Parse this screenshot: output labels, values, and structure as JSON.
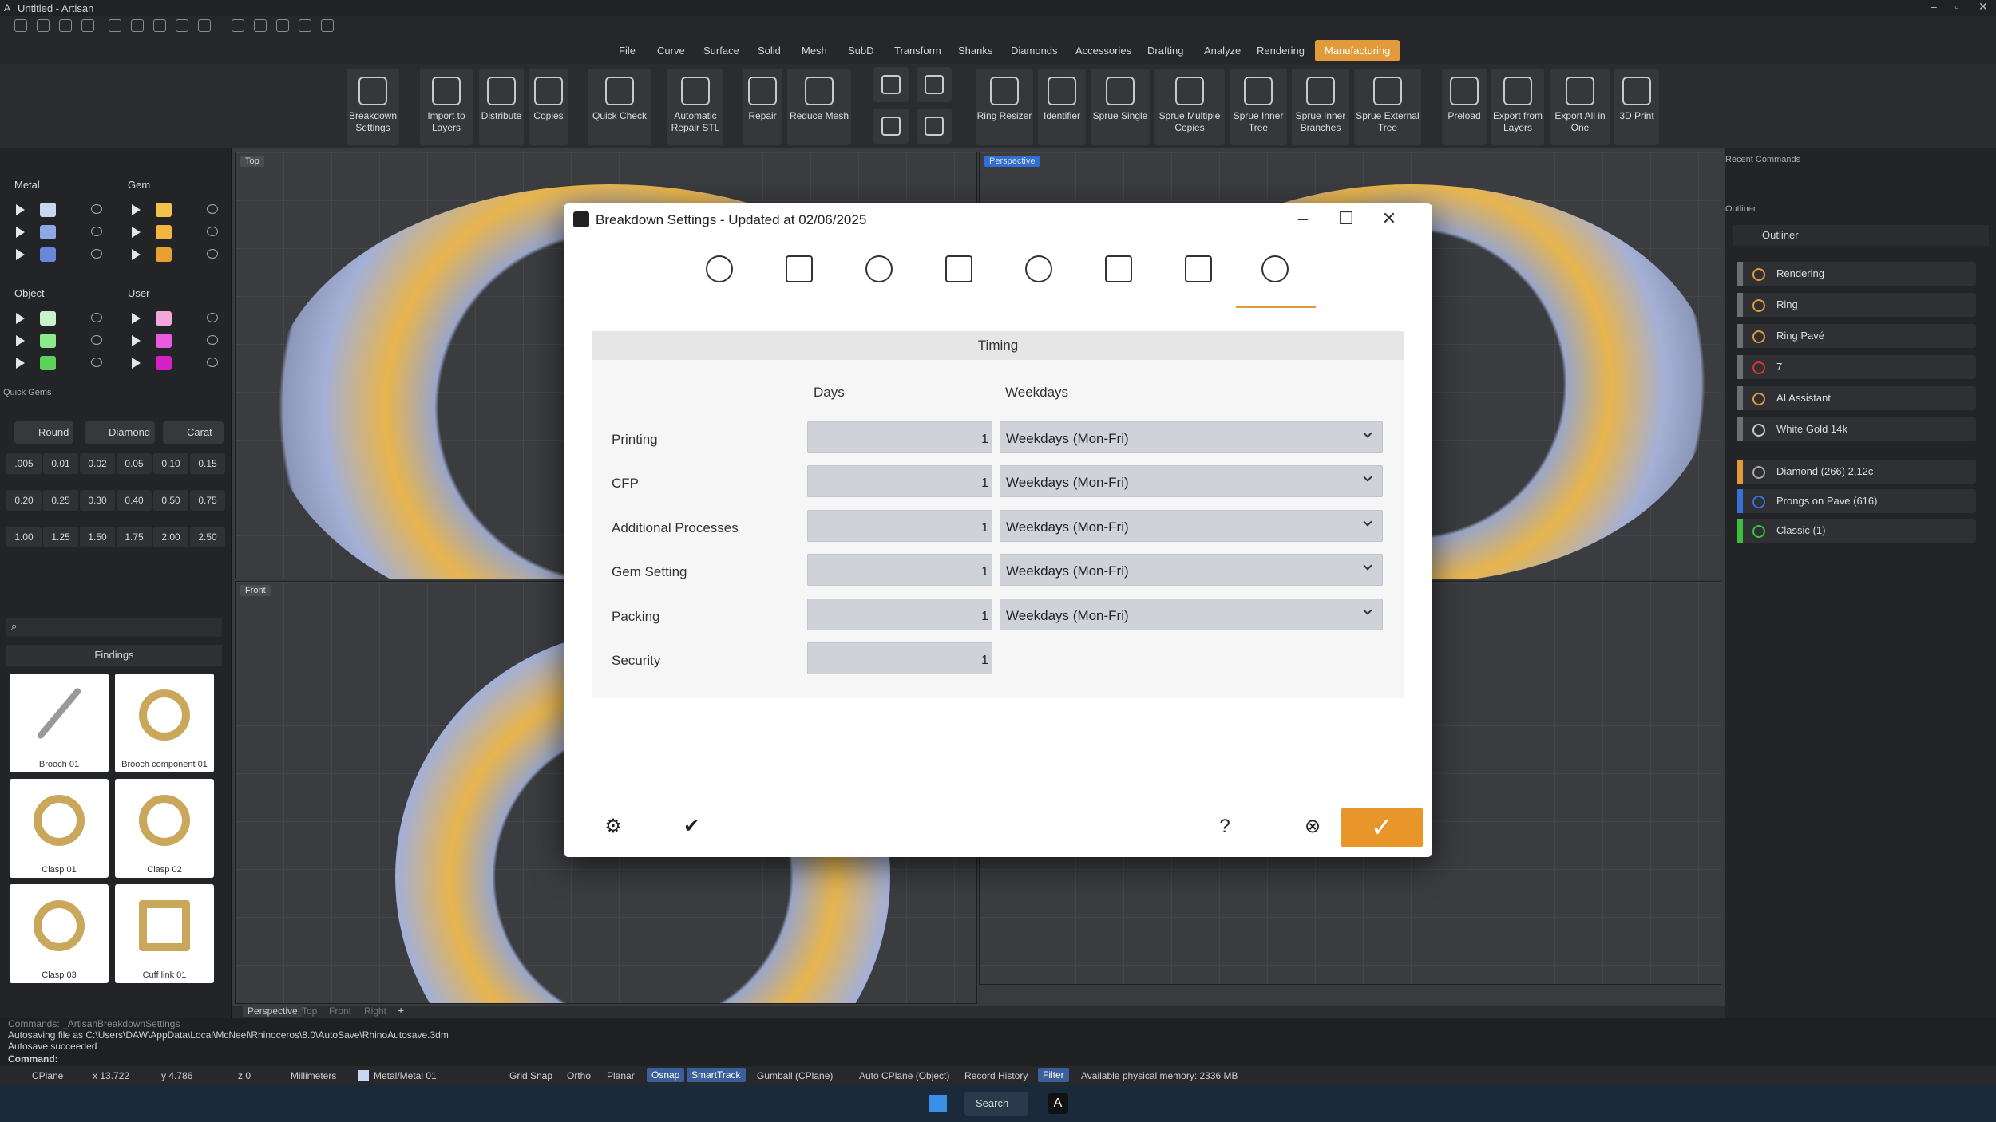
{
  "app": {
    "title": "Untitled - Artisan"
  },
  "menus": [
    "File",
    "Curve",
    "Surface",
    "Solid",
    "Mesh",
    "SubD",
    "Transform",
    "Shanks",
    "Diamonds",
    "Accessories",
    "Drafting",
    "Analyze",
    "Rendering",
    "Manufacturing"
  ],
  "active_menu": "Manufacturing",
  "toolbar": [
    {
      "label": "Breakdown Settings",
      "icon": "breakdown-icon"
    },
    {
      "label": "Import to Layers",
      "icon": "import-icon"
    },
    {
      "label": "Distribute",
      "icon": "distribute-icon"
    },
    {
      "label": "Copies",
      "icon": "copies-icon"
    },
    {
      "label": "Quick Check",
      "icon": "check-icon"
    },
    {
      "label": "Automatic Repair STL",
      "icon": "repair-stl-icon"
    },
    {
      "label": "Repair",
      "icon": "repair-icon"
    },
    {
      "label": "Reduce Mesh",
      "icon": "reduce-mesh-icon"
    },
    {
      "label": "Ring Resizer",
      "icon": "ring-resizer-icon"
    },
    {
      "label": "Identifier",
      "icon": "identifier-icon"
    },
    {
      "label": "Sprue Single",
      "icon": "sprue-icon"
    },
    {
      "label": "Sprue Multiple Copies",
      "icon": "sprue-multi-icon"
    },
    {
      "label": "Sprue Inner Tree",
      "icon": "sprue-tree-icon"
    },
    {
      "label": "Sprue Inner Branches",
      "icon": "sprue-branch-icon"
    },
    {
      "label": "Sprue External Tree",
      "icon": "sprue-ext-icon"
    },
    {
      "label": "Preload",
      "icon": "preload-icon"
    },
    {
      "label": "Export from Layers",
      "icon": "export-layers-icon"
    },
    {
      "label": "Export All in One",
      "icon": "export-all-icon"
    },
    {
      "label": "3D Print",
      "icon": "print-3d-icon"
    }
  ],
  "left": {
    "metal": "Metal",
    "gem": "Gem",
    "object": "Object",
    "user": "User",
    "quick_gems": "Quick Gems",
    "round": "Round",
    "diamond": "Diamond",
    "carat": "Carat",
    "sizes": [
      ".005",
      "0.01",
      "0.02",
      "0.05",
      "0.10",
      "0.15",
      "0.20",
      "0.25",
      "0.30",
      "0.40",
      "0.50",
      "0.75",
      "1.00",
      "1.25",
      "1.50",
      "1.75",
      "2.00",
      "2.50"
    ],
    "findings_title": "Findings",
    "findings": [
      "Brooch 01",
      "Brooch component 01",
      "Clasp 01",
      "Clasp 02",
      "Clasp 03",
      "Cuff link 01"
    ]
  },
  "viewports": {
    "top": "Top",
    "perspective": "Perspective",
    "front": "Front",
    "tabs": [
      "Perspective",
      "Top",
      "Front",
      "Right"
    ]
  },
  "right": {
    "recent": "Recent Commands",
    "outliner_h": "Outliner",
    "outliner": "Outliner",
    "items": [
      "Rendering",
      "Ring",
      "Ring Pavé",
      "7",
      "AI Assistant",
      "White Gold 14k"
    ],
    "objects": [
      "Diamond (266) 2,12c",
      "Prongs on Pave (616)",
      "Classic (1)"
    ]
  },
  "status": {
    "history": "Commands: _ArtisanBreakdownSettings",
    "line1": "Autosaving file as C:\\Users\\DAW\\AppData\\Local\\McNeel\\Rhinoceros\\8.0\\AutoSave\\RhinoAutosave.3dm",
    "line2": "Autosave succeeded",
    "command": "Command:",
    "cplane": "CPlane",
    "x": "x 13.722",
    "y": "y 4.786",
    "z": "z 0",
    "units": "Millimeters",
    "layer": "Metal/Metal 01",
    "gridsnap": "Grid Snap",
    "ortho": "Ortho",
    "planar": "Planar",
    "osnap": "Osnap",
    "smarttrack": "SmartTrack",
    "gumball": "Gumball (CPlane)",
    "autocplane": "Auto CPlane (Object)",
    "record": "Record History",
    "filter": "Filter",
    "memory": "Available physical memory: 2336 MB"
  },
  "taskbar": {
    "search": "Search"
  },
  "dialog": {
    "title": "Breakdown Settings - Updated at 02/06/2025",
    "section": "Timing",
    "col_days": "Days",
    "col_weekdays": "Weekdays",
    "rows": [
      {
        "label": "Printing",
        "days": "1",
        "weekdays": "Weekdays (Mon-Fri)"
      },
      {
        "label": "CFP",
        "days": "1",
        "weekdays": "Weekdays (Mon-Fri)"
      },
      {
        "label": "Additional Processes",
        "days": "1",
        "weekdays": "Weekdays (Mon-Fri)"
      },
      {
        "label": "Gem Setting",
        "days": "1",
        "weekdays": "Weekdays (Mon-Fri)"
      },
      {
        "label": "Packing",
        "days": "1",
        "weekdays": "Weekdays (Mon-Fri)"
      },
      {
        "label": "Security",
        "days": "1"
      }
    ],
    "help": "?"
  }
}
